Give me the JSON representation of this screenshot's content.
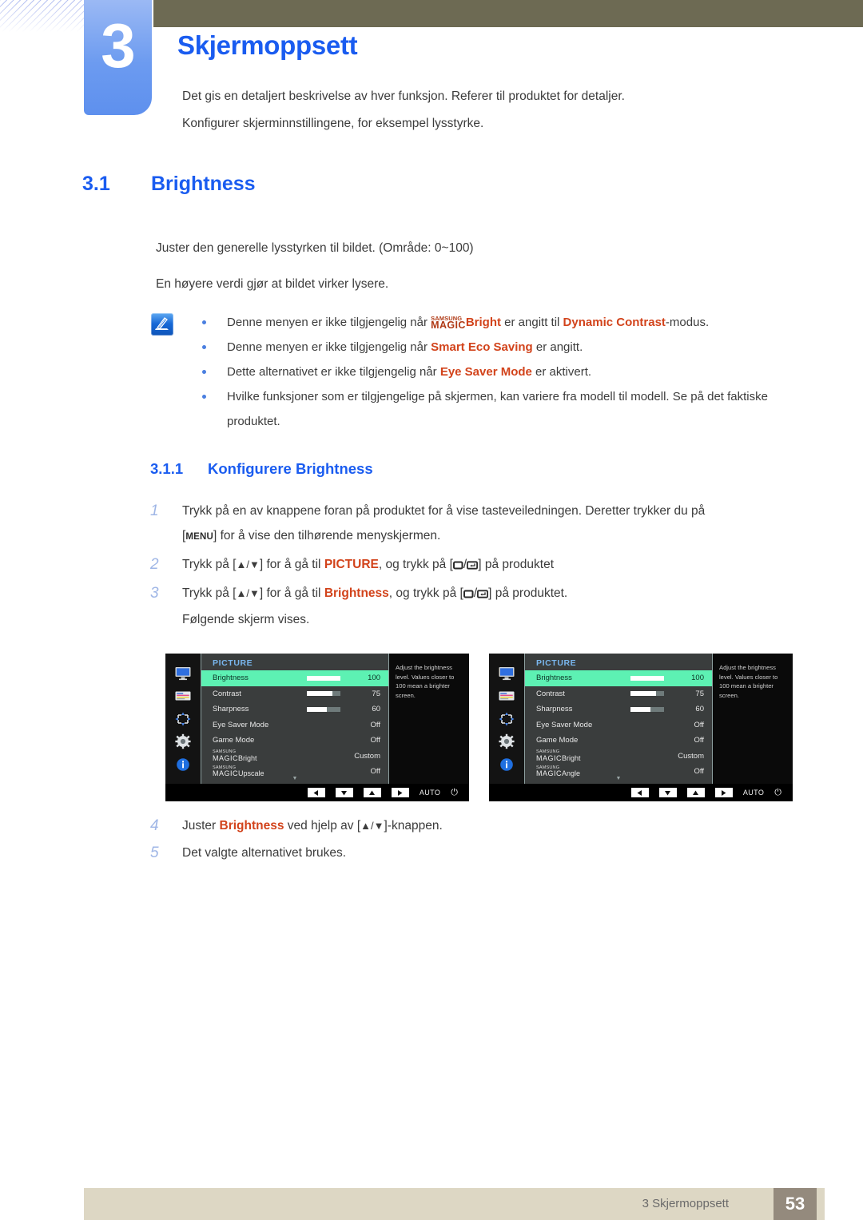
{
  "chapter": {
    "number": "3",
    "title": "Skjermoppsett",
    "intro_line1": "Det gis en detaljert beskrivelse av hver funksjon. Referer til produktet for detaljer.",
    "intro_line2": "Konfigurer skjerminnstillingene, for eksempel lysstyrke."
  },
  "section": {
    "number": "3.1",
    "title": "Brightness",
    "paragraph1": "Juster den generelle lysstyrken til bildet. (Område: 0~100)",
    "paragraph2": "En høyere verdi gjør at bildet virker lysere."
  },
  "note": {
    "icon": "note-pencil-icon",
    "bullets": [
      {
        "pre": "Denne menyen er ikke tilgjengelig når ",
        "magic_top": "SAMSUNG",
        "magic_bottom": "MAGIC",
        "magic_suffix": "Bright",
        "mid": " er angitt til ",
        "highlight": "Dynamic Contrast",
        "post": "-modus."
      },
      {
        "pre": "Denne menyen er ikke tilgjengelig når ",
        "highlight": "Smart Eco Saving",
        "post": " er angitt."
      },
      {
        "pre": "Dette alternativet er ikke tilgjengelig når ",
        "highlight": "Eye Saver Mode",
        "post": " er aktivert."
      },
      {
        "pre": "Hvilke funksjoner som er tilgjengelige på skjermen, kan variere fra modell til modell. Se på det faktiske produktet."
      }
    ]
  },
  "subsection": {
    "number": "3.1.1",
    "title": "Konfigurere Brightness"
  },
  "steps": {
    "step1_num": "1",
    "step1_text": "Trykk på en av knappene foran på produktet for å vise tasteveiledningen. Deretter trykker du på",
    "step1_key": "MENU",
    "step1_text2": "for å vise den tilhørende menyskjermen.",
    "step2_num": "2",
    "step2_pre": "Trykk på [",
    "step2_arrows": "▲/▼",
    "step2_mid": "] for å gå til ",
    "step2_target": "PICTURE",
    "step2_mid2": ", og trykk på [",
    "step2_post": "] på produktet",
    "step3_num": "3",
    "step3_pre": "Trykk på [",
    "step3_arrows": "▲/▼",
    "step3_mid": "] for å gå til ",
    "step3_target": "Brightness",
    "step3_mid2": ", og trykk på [",
    "step3_post": "] på produktet.",
    "step3_sub": "Følgende skjerm vises.",
    "step4_num": "4",
    "step4_pre": "Juster ",
    "step4_target": "Brightness",
    "step4_mid": " ved hjelp av [",
    "step4_arrows": "▲/▼",
    "step4_post": "]-knappen.",
    "step5_num": "5",
    "step5_text": "Det valgte alternativet brukes."
  },
  "osd": {
    "title": "PICTURE",
    "help_text": "Adjust the brightness level. Values closer to 100 mean a brighter screen.",
    "caret": "▼",
    "auto_label": "AUTO",
    "power_icon": "⏻",
    "rail_icons": [
      "monitor-icon",
      "color-panel-icon",
      "four-arrows-icon",
      "gear-icon",
      "info-icon"
    ],
    "button_icons": [
      "arrow-left-icon",
      "arrow-down-icon",
      "arrow-up-icon",
      "arrow-right-icon"
    ],
    "menu_a": [
      {
        "label": "Brightness",
        "value": "100",
        "bar": 100,
        "selected": true
      },
      {
        "label": "Contrast",
        "value": "75",
        "bar": 75,
        "selected": false
      },
      {
        "label": "Sharpness",
        "value": "60",
        "bar": 60,
        "selected": false
      },
      {
        "label": "Eye Saver Mode",
        "value": "Off",
        "bar": null,
        "selected": false
      },
      {
        "label": "Game Mode",
        "value": "Off",
        "bar": null,
        "selected": false
      },
      {
        "magic_top": "SAMSUNG",
        "magic_bottom": "MAGIC",
        "magic_suffix": "Bright",
        "value": "Custom",
        "bar": null,
        "selected": false
      },
      {
        "magic_top": "SAMSUNG",
        "magic_bottom": "MAGIC",
        "magic_suffix": "Upscale",
        "value": "Off",
        "bar": null,
        "selected": false
      }
    ],
    "menu_b": [
      {
        "label": "Brightness",
        "value": "100",
        "bar": 100,
        "selected": true
      },
      {
        "label": "Contrast",
        "value": "75",
        "bar": 75,
        "selected": false
      },
      {
        "label": "Sharpness",
        "value": "60",
        "bar": 60,
        "selected": false
      },
      {
        "label": "Eye Saver Mode",
        "value": "Off",
        "bar": null,
        "selected": false
      },
      {
        "label": "Game Mode",
        "value": "Off",
        "bar": null,
        "selected": false
      },
      {
        "magic_top": "SAMSUNG",
        "magic_bottom": "MAGIC",
        "magic_suffix": "Bright",
        "value": "Custom",
        "bar": null,
        "selected": false
      },
      {
        "magic_top": "SAMSUNG",
        "magic_bottom": "MAGIC",
        "magic_suffix": "Angle",
        "value": "Off",
        "bar": null,
        "selected": false
      }
    ]
  },
  "footer": {
    "label": "3 Skjermoppsett",
    "page": "53"
  },
  "colors": {
    "heading_blue": "#1a5cf0",
    "chapter_block": "#6c9bf0",
    "topbar_olive": "#6d6a53",
    "accent_red": "#d2431b",
    "osd_highlight": "#5df1b3",
    "footer_bar": "#ddd7c4",
    "footer_badge": "#948a7d"
  }
}
